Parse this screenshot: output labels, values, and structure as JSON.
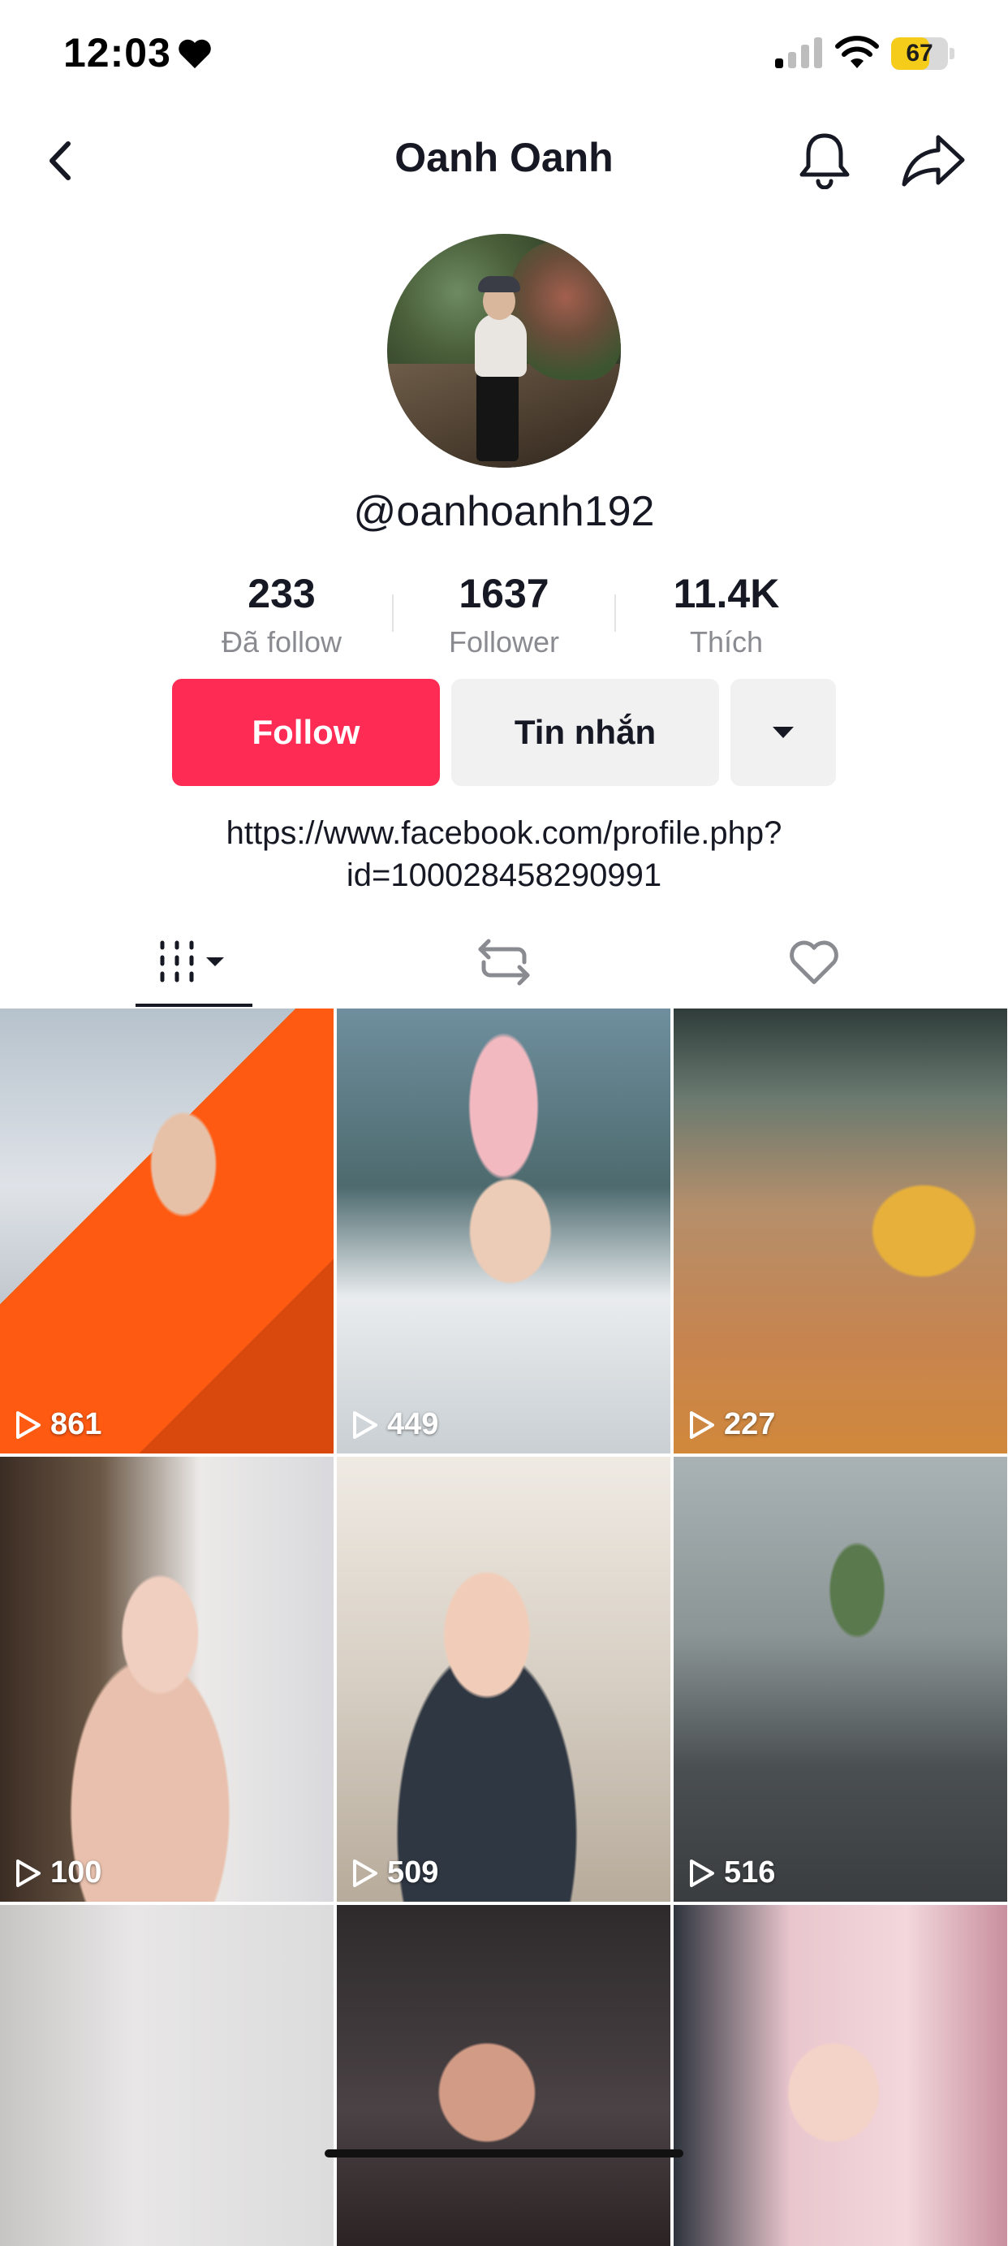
{
  "status_bar": {
    "time": "12:03",
    "battery": "67",
    "battery_level": 0.67,
    "icons": [
      "heart-icon",
      "signal-icon",
      "wifi-icon",
      "battery-icon"
    ]
  },
  "nav": {
    "title": "Oanh Oanh",
    "icons": [
      "back-chevron-icon",
      "bell-icon",
      "share-arrow-icon"
    ]
  },
  "profile": {
    "username": "@oanhoanh192",
    "stats": [
      {
        "value": "233",
        "label": "Đã follow"
      },
      {
        "value": "1637",
        "label": "Follower"
      },
      {
        "value": "11.4K",
        "label": "Thích"
      }
    ],
    "actions": {
      "follow_label": "Follow",
      "message_label": "Tin nhắn"
    },
    "bio_line1": "https://www.facebook.com/profile.php?",
    "bio_line2": "id=100028458290991"
  },
  "tabs": [
    {
      "name": "videos",
      "icon": "grid-dropdown-icon",
      "active": true
    },
    {
      "name": "reposts",
      "icon": "repost-icon",
      "active": false
    },
    {
      "name": "liked",
      "icon": "heart-outline-icon",
      "active": false
    }
  ],
  "videos": [
    {
      "views": "861"
    },
    {
      "views": "449"
    },
    {
      "views": "227"
    },
    {
      "views": "100"
    },
    {
      "views": "509"
    },
    {
      "views": "516"
    },
    {
      "views": ""
    },
    {
      "views": ""
    },
    {
      "views": ""
    }
  ],
  "colors": {
    "accent": "#fe2c55",
    "text": "#161823",
    "muted": "#8a8b91",
    "button_bg": "#f1f1f2",
    "battery": "#f5cc19"
  }
}
